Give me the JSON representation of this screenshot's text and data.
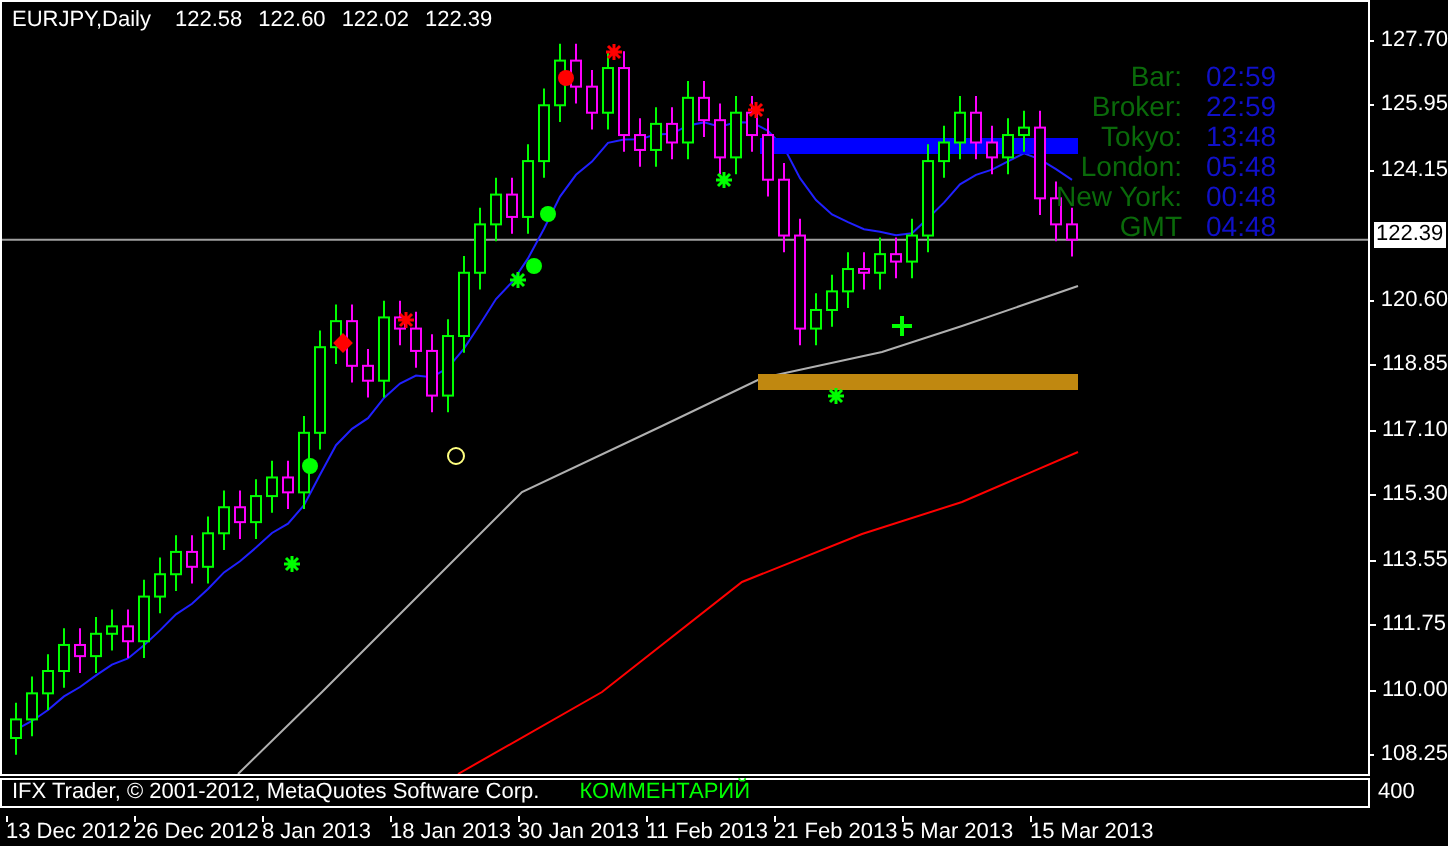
{
  "title": {
    "symbol": "EURJPY,Daily",
    "ohlc": [
      "122.58",
      "122.60",
      "122.02",
      "122.39"
    ]
  },
  "sessions": [
    {
      "label": "Bar:",
      "time": "02:59"
    },
    {
      "label": "Broker:",
      "time": "22:59"
    },
    {
      "label": "Tokyo:",
      "time": "13:48"
    },
    {
      "label": "London:",
      "time": "05:48"
    },
    {
      "label": "New York:",
      "time": "00:48"
    },
    {
      "label": "GMT",
      "time": "04:48"
    }
  ],
  "price_axis": {
    "ticks": [
      "127.70",
      "125.95",
      "124.15",
      "120.60",
      "118.85",
      "117.10",
      "115.30",
      "113.55",
      "111.75",
      "110.00",
      "108.25"
    ],
    "current": "122.39"
  },
  "time_axis": {
    "ticks": [
      "13 Dec 2012",
      "26 Dec 2012",
      "8 Jan 2013",
      "18 Jan 2013",
      "30 Jan 2013",
      "11 Feb 2013",
      "21 Feb 2013",
      "5 Mar 2013",
      "15 Mar 2013"
    ]
  },
  "subwindow": {
    "copyright": "IFX Trader, © 2001-2012, MetaQuotes Software Corp.",
    "comment": "КОММЕНТАРИЙ",
    "axis_label": "400"
  }
}
